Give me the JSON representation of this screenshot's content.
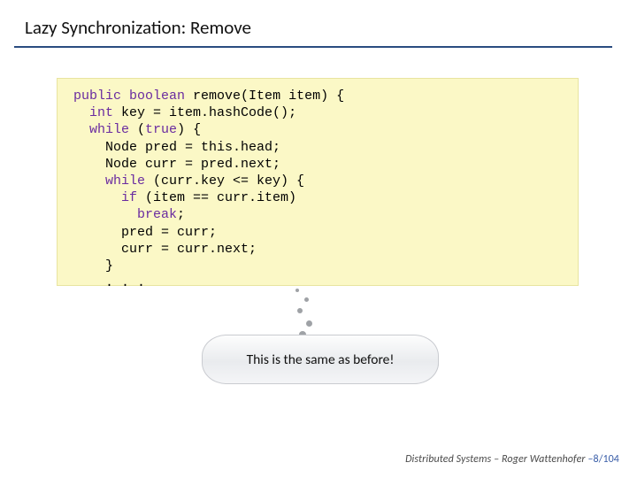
{
  "title": "Lazy Synchronization: Remove",
  "code": {
    "l1a": "public",
    "l1b": "boolean",
    "l1c": " remove(Item item) {",
    "l2a": "int",
    "l2b": " key = item.hashCode();",
    "l3a": "while",
    "l3b": " (",
    "l3c": "true",
    "l3d": ") {",
    "l4": "    Node pred = this.head;",
    "l5": "    Node curr = pred.next;",
    "l6a": "while",
    "l6b": " (curr.key <= key) {",
    "l7a": "if",
    "l7b": " (item == curr.item)",
    "l8a": "break",
    "l8b": ";",
    "l9": "      pred = curr;",
    "l10": "      curr = curr.next;",
    "l11": "    }",
    "l12": "    . . ."
  },
  "callout": "This is the same as before!",
  "footer": {
    "course": "Distributed Systems",
    "sep": "  –  ",
    "author": "Roger Wattenhofer",
    "page_prefix": "  –",
    "page": "8/104"
  }
}
